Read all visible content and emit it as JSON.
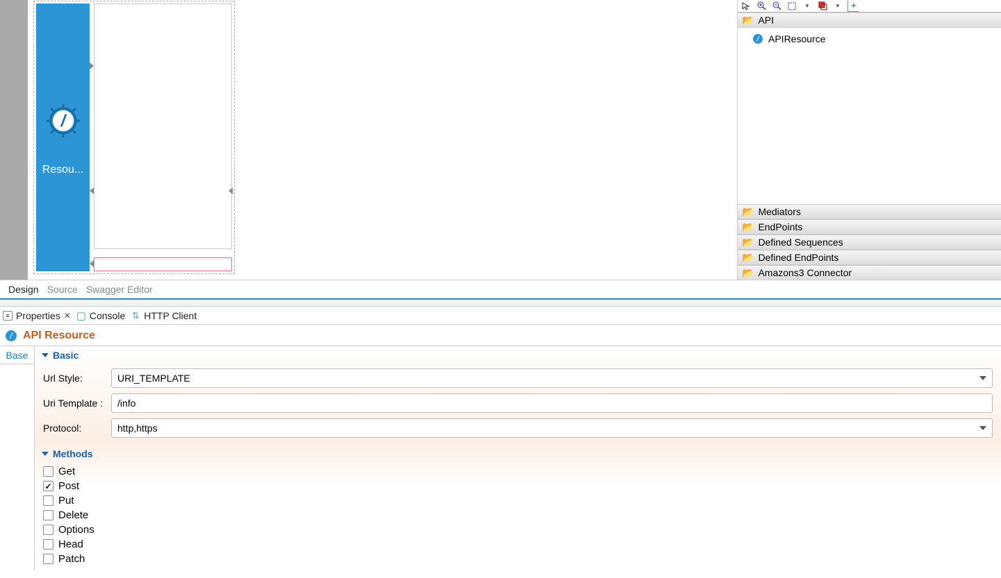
{
  "canvas": {
    "resource_label": "Resou..."
  },
  "palette": {
    "sections": {
      "api": "API",
      "api_item": "APIResource",
      "mediators": "Mediators",
      "endpoints": "EndPoints",
      "defined_sequences": "Defined Sequences",
      "defined_endpoints": "Defined EndPoints",
      "amazons3": "Amazons3 Connector"
    }
  },
  "editor_tabs": {
    "design": "Design",
    "source": "Source",
    "swagger": "Swagger Editor"
  },
  "view_tabs": {
    "properties": "Properties",
    "console": "Console",
    "http_client": "HTTP Client"
  },
  "res_header": {
    "title": "API Resource"
  },
  "side_tabs": {
    "base": "Base"
  },
  "sections": {
    "basic": "Basic",
    "methods": "Methods"
  },
  "form": {
    "url_style_label": "Url Style:",
    "url_style_value": "URI_TEMPLATE",
    "uri_template_label": "Uri Template :",
    "uri_template_value": "/info",
    "protocol_label": "Protocol:",
    "protocol_value": "http,https"
  },
  "methods": [
    {
      "label": "Get",
      "checked": false
    },
    {
      "label": "Post",
      "checked": true
    },
    {
      "label": "Put",
      "checked": false
    },
    {
      "label": "Delete",
      "checked": false
    },
    {
      "label": "Options",
      "checked": false
    },
    {
      "label": "Head",
      "checked": false
    },
    {
      "label": "Patch",
      "checked": false
    }
  ]
}
